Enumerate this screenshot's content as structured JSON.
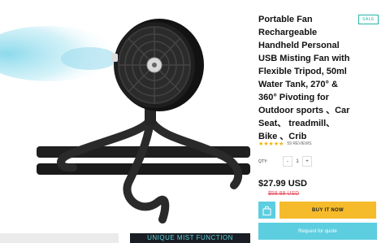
{
  "product": {
    "title": "Portable Fan Rechargeable Handheld Personal USB Misting Fan with Flexible Tripod, 50ml Water Tank, 270° & 360° Pivoting for Outdoor sports 、Car Seat、 treadmill、 Bike 、Crib",
    "badge": "SALE",
    "rating": {
      "stars": "★★★★★",
      "reviews": "59 REVIEWS"
    },
    "quantity": {
      "label": "QTY:",
      "minus": "-",
      "value": "1",
      "plus": "+"
    },
    "price": "$27.99 USD",
    "compare_price": "$58.88 USD",
    "buy_now_label": "BUY IT NOW",
    "quote_label": "Request for quote"
  },
  "thumbnails": {
    "second_caption": "UNIQUE MIST FUNCTION"
  },
  "icons": {
    "cart": "shopping-bag-icon"
  },
  "colors": {
    "accent": "#5dcee0",
    "buy": "#f5bb2b",
    "sale": "#27b5a8",
    "compare": "#e94c5c",
    "stars": "#f3b200"
  }
}
